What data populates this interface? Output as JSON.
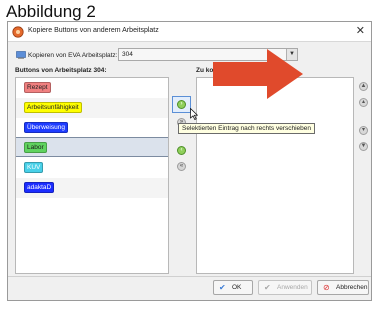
{
  "caption": "Abbildung 2",
  "window": {
    "title": "Kopiere Buttons von anderem Arbeitsplatz",
    "close_glyph": "✕"
  },
  "copy_from": {
    "label": "Kopieren von EVA Arbeitsplatz:",
    "value": "304",
    "arrow_glyph": "▼"
  },
  "left_panel": {
    "header": "Buttons von Arbeitsplatz 304:",
    "items": [
      {
        "label": "Rezept",
        "bg": "#f08080",
        "fg": "#222222",
        "selected": false
      },
      {
        "label": "Arbeitsunfähigkeit",
        "bg": "#ffff00",
        "fg": "#222222",
        "selected": false
      },
      {
        "label": "Überweisung",
        "bg": "#1e3cff",
        "fg": "#ffffff",
        "selected": false
      },
      {
        "label": "Labor",
        "bg": "#5fd35f",
        "fg": "#1a1a1a",
        "selected": true
      },
      {
        "label": "KUV",
        "bg": "#48d0e8",
        "fg": "#ffffff",
        "selected": false
      },
      {
        "label": "adaktaD",
        "bg": "#1b2dff",
        "fg": "#ffffff",
        "selected": false
      }
    ]
  },
  "right_panel": {
    "header": "Zu kopierende Buttons:"
  },
  "tooltip": "Selektierten Eintrag nach rechts verschieben",
  "buttons": {
    "ok": "OK",
    "apply": "Anwenden",
    "cancel": "Abbrechen"
  },
  "colors": {
    "arrow": "#e04a2c",
    "window_bg": "#f0f0f0",
    "selection": "#dbe2ec"
  }
}
